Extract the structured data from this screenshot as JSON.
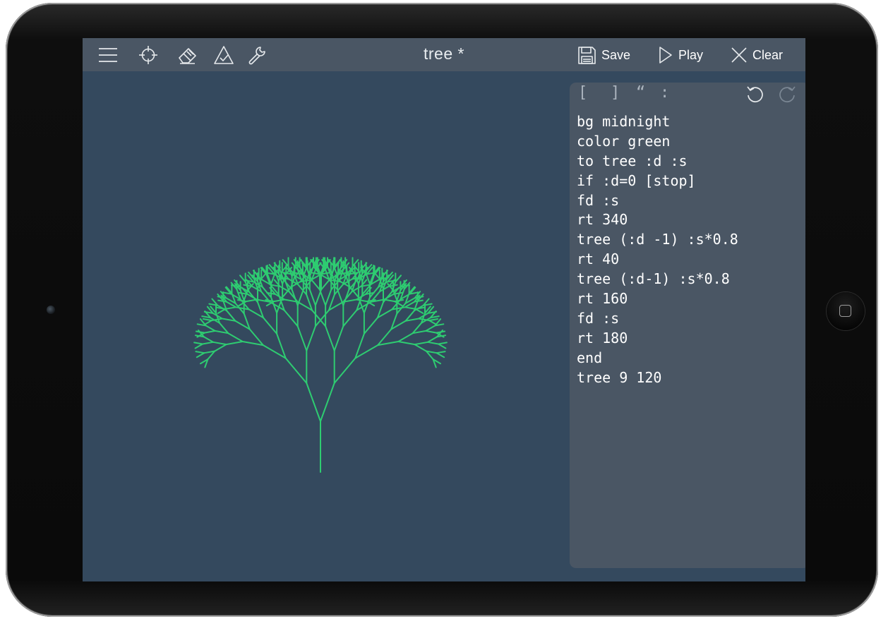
{
  "toolbar": {
    "icons": [
      "menu-icon",
      "crosshair-icon",
      "eraser-icon",
      "triangle-check-icon",
      "wrench-icon"
    ],
    "title": "tree *",
    "save_label": "Save",
    "play_label": "Play",
    "clear_label": "Clear"
  },
  "editor": {
    "symbols": [
      "[",
      "]",
      "“",
      ":"
    ],
    "code_lines": [
      "bg midnight",
      "color green",
      "to tree :d :s",
      "if :d=0 [stop]",
      "fd :s",
      "rt 340",
      "tree (:d -1) :s*0.8",
      "rt 40",
      "tree (:d-1) :s*0.8",
      "rt 160",
      "fd :s",
      "rt 180",
      "end",
      "tree 9 120"
    ]
  },
  "canvas": {
    "background": "#34495e",
    "pen_color": "#2ecc71",
    "program": {
      "depth": 9,
      "size": 120,
      "turn_left_deg": 20,
      "turn_right_deg": 40,
      "scale": 0.8
    }
  },
  "colors": {
    "toolbar_bg": "#4a5664",
    "editor_bg": "#4a5664",
    "screen_bg": "#34495e"
  }
}
